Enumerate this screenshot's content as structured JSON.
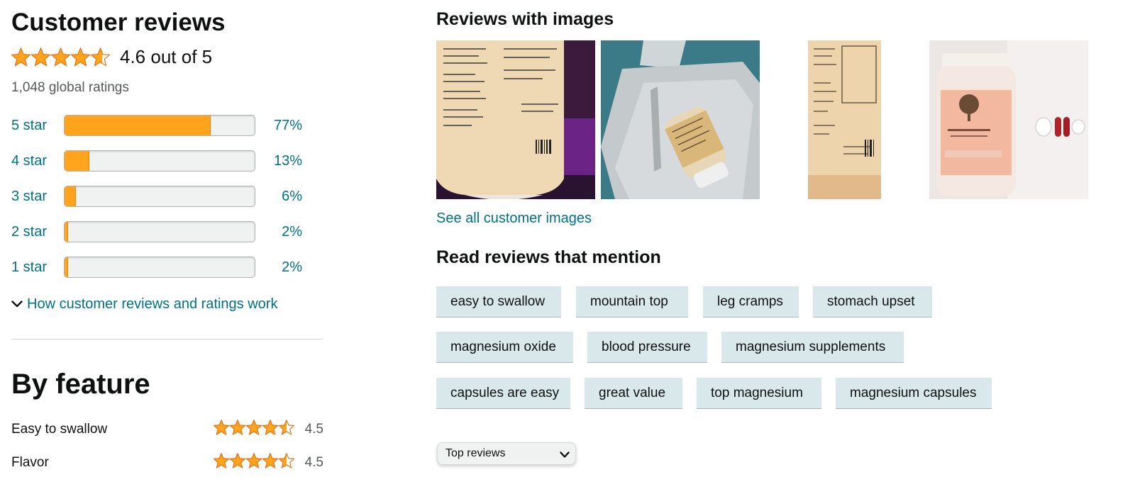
{
  "customer_reviews": {
    "title": "Customer reviews",
    "rating_value": 4.6,
    "rating_text": "4.6 out of 5",
    "global_ratings": "1,048 global ratings",
    "histogram": [
      {
        "label": "5 star",
        "percent_text": "77%",
        "fraction": 0.77
      },
      {
        "label": "4 star",
        "percent_text": "13%",
        "fraction": 0.13
      },
      {
        "label": "3 star",
        "percent_text": "6%",
        "fraction": 0.06
      },
      {
        "label": "2 star",
        "percent_text": "2%",
        "fraction": 0.02
      },
      {
        "label": "1 star",
        "percent_text": "2%",
        "fraction": 0.02
      }
    ],
    "how_link": "How customer reviews and ratings work"
  },
  "by_feature": {
    "title": "By feature",
    "features": [
      {
        "name": "Easy to swallow",
        "rating": "4.5",
        "stars": 4.5
      },
      {
        "name": "Flavor",
        "rating": "4.5",
        "stars": 4.5
      }
    ]
  },
  "images_section": {
    "title": "Reviews with images",
    "see_all": "See all customer images",
    "images": [
      {
        "icon": "customer-photo-bottle-label-purple"
      },
      {
        "icon": "customer-photo-bottle-on-tray"
      },
      {
        "icon": "customer-photo-bottle-label-narrow"
      },
      {
        "icon": "customer-photo-magnesium-bottle-capsules"
      }
    ]
  },
  "mentions": {
    "title": "Read reviews that mention",
    "rows": [
      [
        "easy to swallow",
        "mountain top",
        "leg cramps",
        "stomach upset"
      ],
      [
        "magnesium oxide",
        "blood pressure",
        "magnesium supplements"
      ],
      [
        "capsules are easy",
        "great value",
        "top magnesium",
        "magnesium capsules"
      ]
    ]
  },
  "sort": {
    "selected": "Top reviews"
  },
  "colors": {
    "star": "#ffa41c",
    "link": "#007185",
    "chip_bg": "#d9e8eb"
  }
}
